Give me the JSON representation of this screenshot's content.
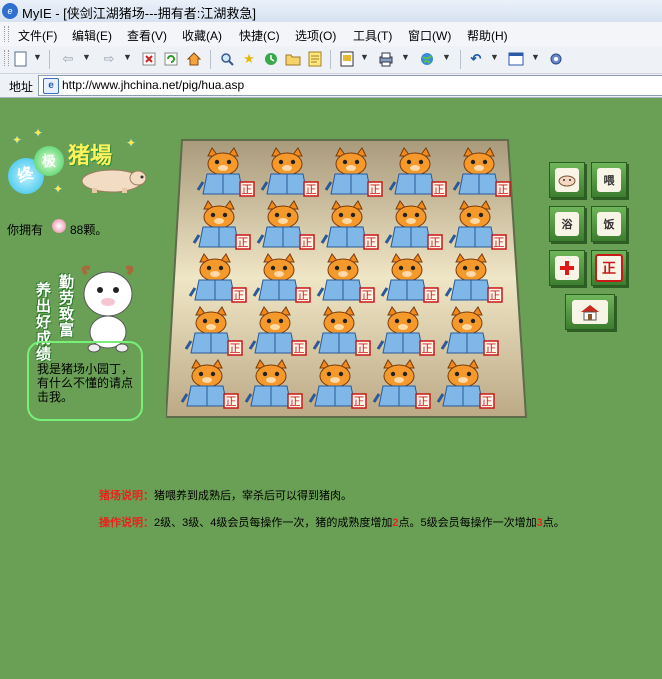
{
  "window": {
    "title": "MyIE - [侠剑江湖猪场---拥有者:江湖救急]"
  },
  "menu": [
    "文件(F)",
    "编辑(E)",
    "查看(V)",
    "收藏(A)",
    "快捷(C)",
    "选项(O)",
    "工具(T)",
    "窗口(W)",
    "帮助(H)"
  ],
  "toolbar": {
    "icons": [
      "new-page-icon",
      "back-icon",
      "forward-icon",
      "stop-icon",
      "refresh-icon",
      "home-icon",
      "search-icon",
      "favorites-icon",
      "history-icon",
      "folder-icon",
      "notes-icon",
      "page-icon",
      "print-icon",
      "globe-icon",
      "undo-icon",
      "window-icon",
      "settings-icon"
    ]
  },
  "address": {
    "label": "地址",
    "url": "http://www.jhchina.net/pig/hua.asp"
  },
  "logo": {
    "badge1": "终",
    "badge2": "极",
    "title": "猪場"
  },
  "owned": {
    "label": "你拥有",
    "count": "88颗。"
  },
  "gardener": {
    "vtext_left": "养出好成绩",
    "vtext_right": "勤劳致富",
    "bubble": "我是猪场小园丁，有什么不懂的请点击我。"
  },
  "field": {
    "rows": 5,
    "cols": 5,
    "pig_label": "正"
  },
  "actions": [
    {
      "id": "feed-pig",
      "label": ""
    },
    {
      "id": "feed-rice",
      "label": "喂"
    },
    {
      "id": "bath",
      "label": "浴"
    },
    {
      "id": "meal",
      "label": "饭"
    },
    {
      "id": "medical",
      "label": ""
    },
    {
      "id": "stamp",
      "label": "正"
    },
    {
      "id": "house",
      "label": ""
    }
  ],
  "notes": {
    "farm_key": "猪场说明：",
    "farm_text": "猪喂养到成熟后，宰杀后可以得到猪肉。",
    "op_key": "操作说明：",
    "op_text1": "2级、3级、4级会员每操作一次，猪的成熟度增加",
    "op_num1": "2",
    "op_text2": "点。5级会员每操作一次增加",
    "op_num2": "3",
    "op_text3": "点。"
  },
  "colors": {
    "background": "#6aa055",
    "accent_red": "#e8231c"
  }
}
